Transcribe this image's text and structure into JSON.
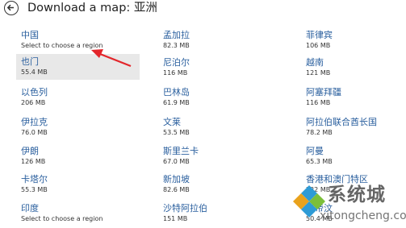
{
  "header": {
    "back_icon": "back-arrow-icon",
    "title": "Download a map: 亚洲"
  },
  "regions": [
    {
      "name": "中国",
      "size": "Select to choose a region"
    },
    {
      "name": "也门",
      "size": "55.4 MB"
    },
    {
      "name": "以色列",
      "size": "206 MB"
    },
    {
      "name": "伊拉克",
      "size": "76.0 MB"
    },
    {
      "name": "伊朗",
      "size": "126 MB"
    },
    {
      "name": "卡塔尔",
      "size": "55.3 MB"
    },
    {
      "name": "印度",
      "size": "Select to choose a region"
    },
    {
      "name": "孟加拉",
      "size": "82.3 MB"
    },
    {
      "name": "尼泊尔",
      "size": "116 MB"
    },
    {
      "name": "巴林岛",
      "size": "61.9 MB"
    },
    {
      "name": "文莱",
      "size": "53.5 MB"
    },
    {
      "name": "斯里兰卡",
      "size": "67.0 MB"
    },
    {
      "name": "新加坡",
      "size": "82.6 MB"
    },
    {
      "name": "沙特阿拉伯",
      "size": "151 MB"
    },
    {
      "name": "菲律宾",
      "size": "106 MB"
    },
    {
      "name": "越南",
      "size": "121 MB"
    },
    {
      "name": "阿塞拜疆",
      "size": "116 MB"
    },
    {
      "name": "阿拉伯联合酋长国",
      "size": "78.2 MB"
    },
    {
      "name": "阿曼",
      "size": "65.3 MB"
    },
    {
      "name": "香港和澳门特区",
      "size": "222 MB"
    },
    {
      "name": "东帝汶",
      "size": "50.4 MB"
    }
  ],
  "colors": {
    "region_name": "#2a5f9e",
    "highlight_background": "#e8e8e8",
    "annotation_arrow": "#e3262b"
  },
  "watermark": {
    "brand": "系统城",
    "domain": "xitongcheng.com"
  }
}
